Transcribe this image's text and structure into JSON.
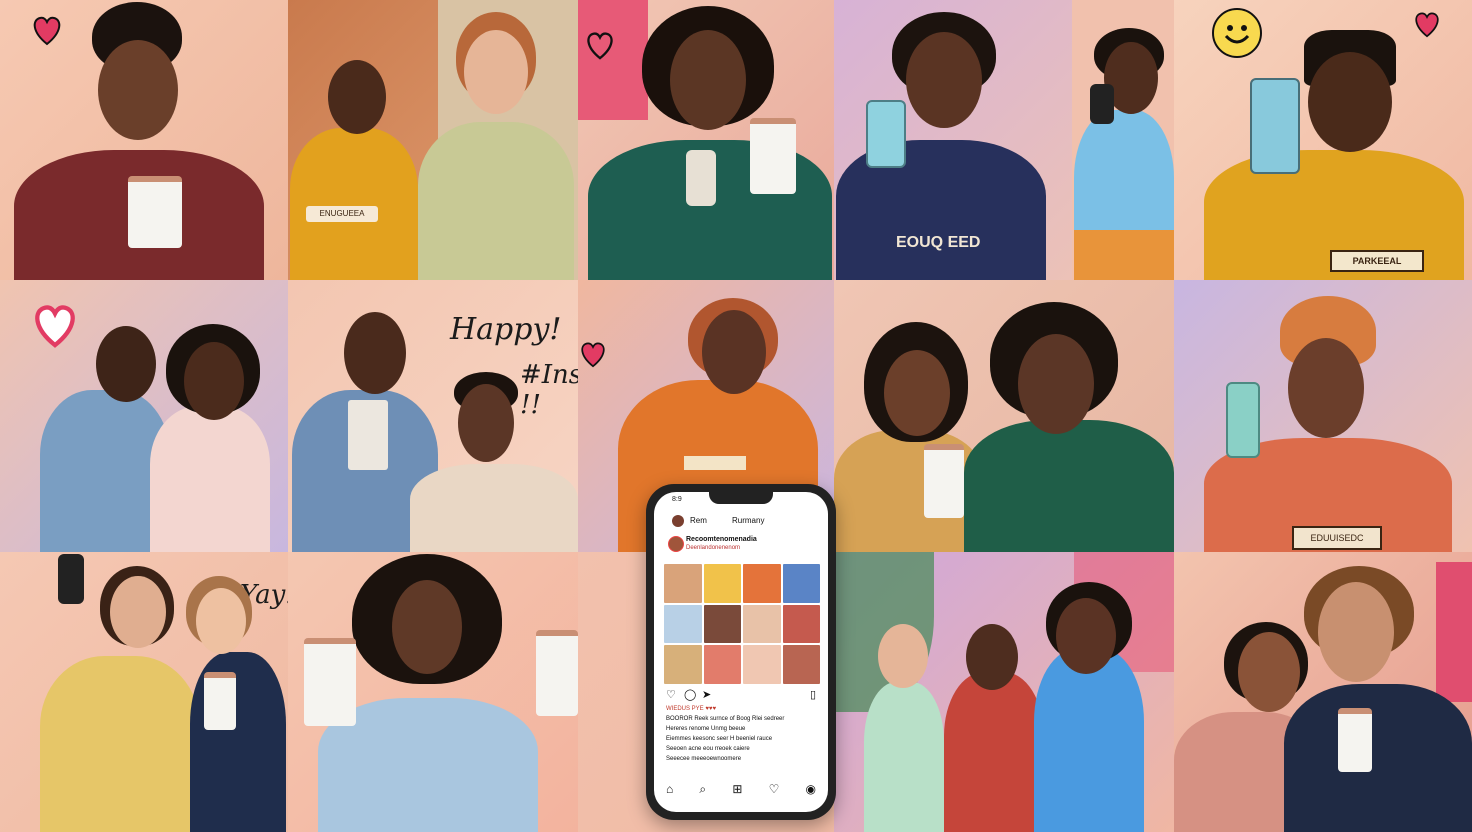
{
  "handwriting": {
    "happy": "Happy!",
    "instagram": "#Instagram !!",
    "yay": "Yay!!"
  },
  "shirt_prints": {
    "p1": "ENUGUEEA",
    "p2": "EOUQ EED",
    "p3": "PARKEEAL",
    "p4": "EDUUISEDC"
  },
  "phone": {
    "status_time": "8:9",
    "user_left": "Rem",
    "user_right": "Rurmany",
    "profile_line1": "Recoomtenomenadia",
    "profile_line2": "Deenlandonenenom",
    "caption_lines": [
      "WIEDUS PYE ♥♥♥",
      "BOOROR Reek surnce of Boog Rlei sedreer",
      "Hereres renome Unmg beeue",
      "Eiemmes keesonc seer H beeniel rauce",
      "Seeoen acne eou rreoek caiere",
      "Seeecee meeeoewnoomere"
    ],
    "nav_icons": [
      "home-icon",
      "search-icon",
      "add-icon",
      "heart-icon",
      "profile-icon"
    ]
  },
  "colors": {
    "heart": "#e23b63",
    "phone_frame": "#222222"
  }
}
